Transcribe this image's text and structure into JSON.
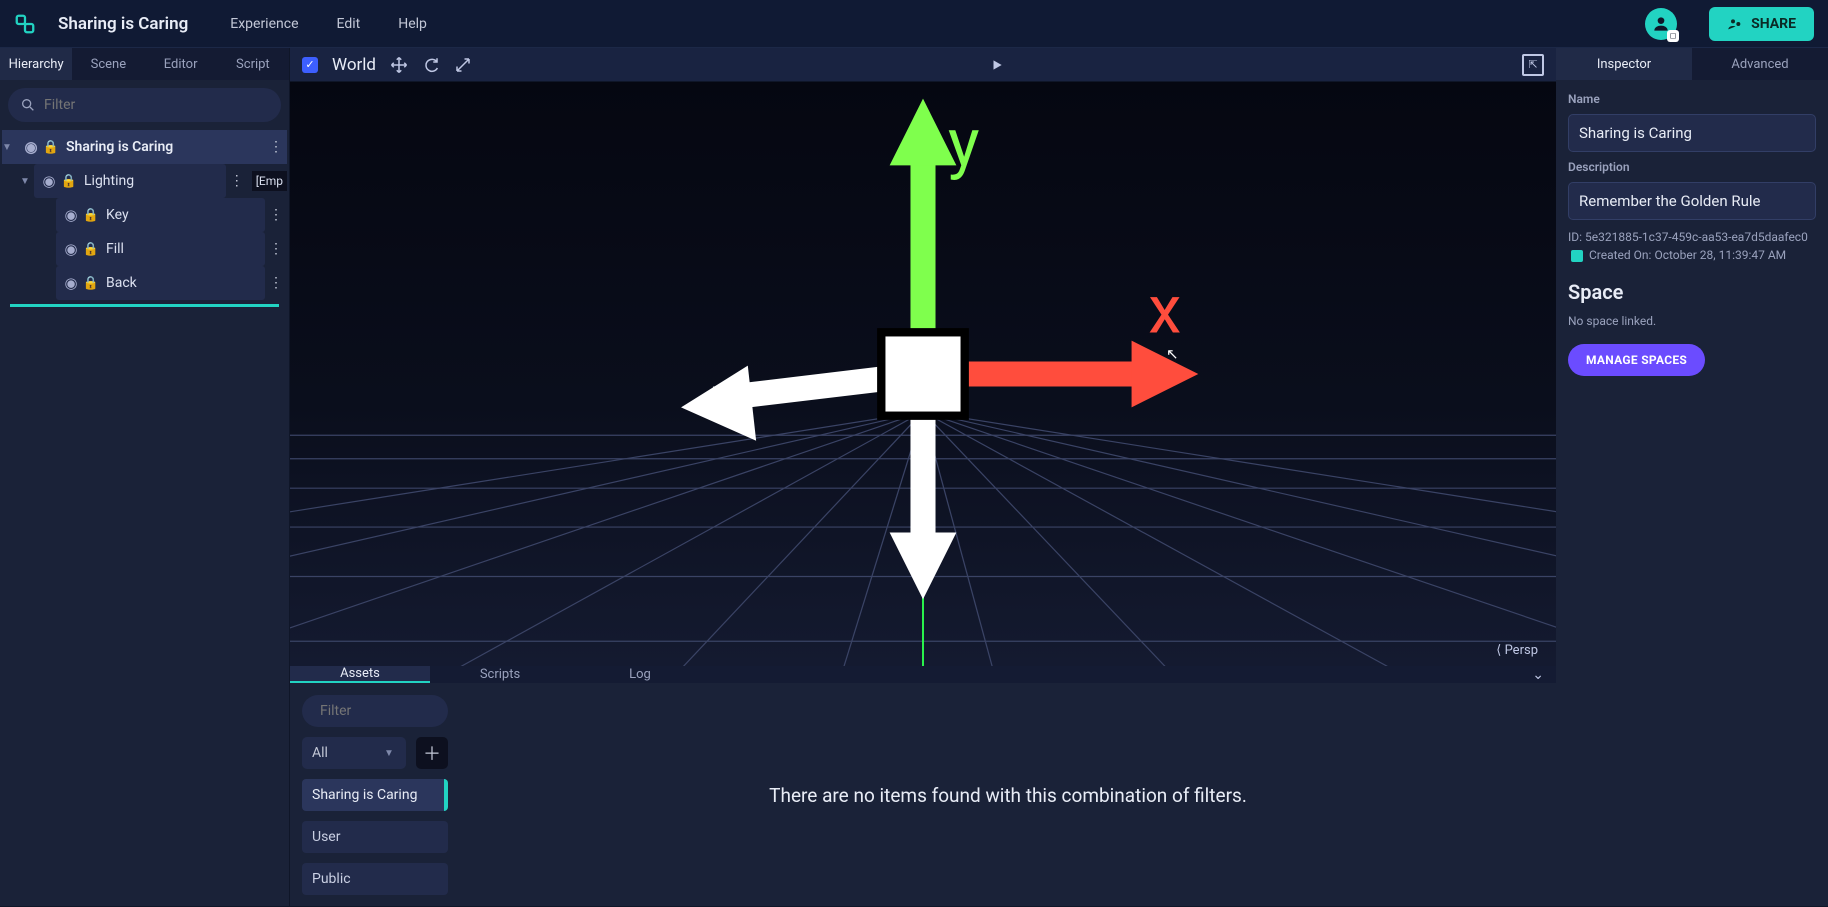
{
  "top": {
    "title": "Sharing is Caring",
    "menus": [
      "Experience",
      "Edit",
      "Help"
    ],
    "share_label": "SHARE"
  },
  "left_tabs": [
    "Hierarchy",
    "Scene",
    "Editor",
    "Script"
  ],
  "filter_placeholder": "Filter",
  "hierarchy": {
    "root": "Sharing is Caring",
    "group": "Lighting",
    "group_tag": "[Emp",
    "children": [
      "Key",
      "Fill",
      "Back"
    ]
  },
  "view": {
    "world_label": "World",
    "persp_label": "Persp"
  },
  "bottom_tabs": [
    "Assets",
    "Scripts",
    "Log"
  ],
  "assets": {
    "filter_placeholder": "Filter",
    "dropdown": "All",
    "categories": [
      "Sharing is Caring",
      "User",
      "Public"
    ],
    "empty_msg": "There are no items found with this combination of filters."
  },
  "right_tabs": [
    "Inspector",
    "Advanced"
  ],
  "inspector": {
    "name_label": "Name",
    "name_value": "Sharing is Caring",
    "desc_label": "Description",
    "desc_value": "Remember the Golden Rule",
    "id_prefix": "ID: ",
    "id_value": "5e321885-1c37-459c-aa53-ea7d5daafec0",
    "created_prefix": " Created On: ",
    "created_value": "October 28, 11:39:47 AM",
    "space_heading": "Space",
    "space_status": "No space linked.",
    "manage_label": "MANAGE SPACES"
  }
}
